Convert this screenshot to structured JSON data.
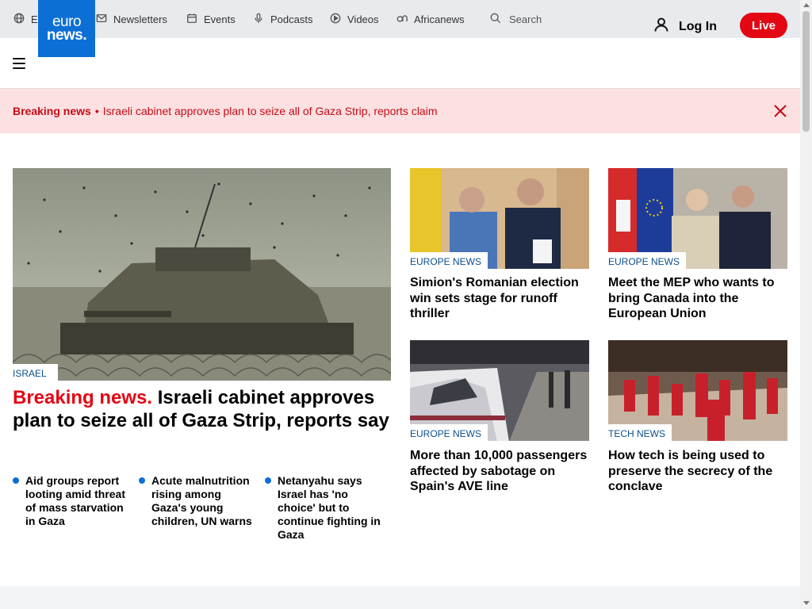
{
  "topbar": {
    "language": "English",
    "links": [
      {
        "label": "Newsletters",
        "icon": "mail-icon"
      },
      {
        "label": "Events",
        "icon": "calendar-icon"
      },
      {
        "label": "Podcasts",
        "icon": "microphone-icon"
      },
      {
        "label": "Videos",
        "icon": "play-icon"
      },
      {
        "label": "Africanews",
        "icon": "africanews-icon"
      }
    ],
    "search_label": "Search"
  },
  "header": {
    "logo_line1": "euro",
    "logo_line2": "news.",
    "login_label": "Log In",
    "live_label": "Live",
    "brand_color": "#0b6fd6",
    "live_color": "#e30613"
  },
  "breaking": {
    "label": "Breaking news",
    "separator": "•",
    "text": "Israeli cabinet approves plan to seize all of Gaza Strip, reports claim",
    "background": "#fde0e1"
  },
  "featured": {
    "tag": "ISRAEL",
    "title_highlight": "Breaking news.",
    "title": "Israeli cabinet approves plan to seize all of Gaza Strip, reports say",
    "related": [
      "Aid groups report looting amid threat of mass starvation in Gaza",
      "Acute malnutrition rising among Gaza's young children, UN warns",
      "Netanyahu says Israel has 'no choice' but to continue fighting in Gaza"
    ]
  },
  "cards": [
    {
      "tag": "EUROPE NEWS",
      "title": "Simion's Romanian election win sets stage for runoff thriller"
    },
    {
      "tag": "EUROPE NEWS",
      "title": "Meet the MEP who wants to bring Canada into the European Union"
    },
    {
      "tag": "EUROPE NEWS",
      "title": "More than 10,000 passengers affected by sabotage on Spain's AVE line"
    },
    {
      "tag": "TECH NEWS",
      "title": "How tech is being used to preserve the secrecy of the conclave"
    }
  ]
}
